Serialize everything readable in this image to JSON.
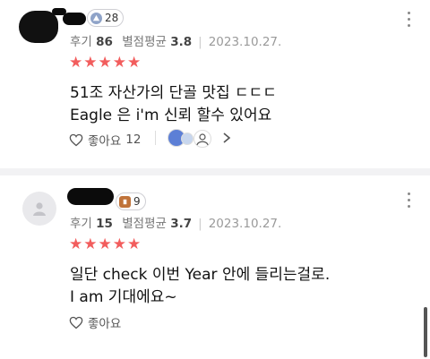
{
  "reviews": [
    {
      "badge_count": "28",
      "review_label": "후기",
      "review_count": "86",
      "avg_label": "별점평균",
      "avg_value": "3.8",
      "date": "2023.10.27.",
      "stars": "★★★★★",
      "lines": [
        "51조 자산가의 단골 맛집 ㄷㄷㄷ",
        "Eagle 은 i'm 신뢰 할수 있어요"
      ],
      "like_label": "좋아요",
      "like_count": "12"
    },
    {
      "badge_count": "9",
      "review_label": "후기",
      "review_count": "15",
      "avg_label": "별점평균",
      "avg_value": "3.7",
      "date": "2023.10.27.",
      "stars": "★★★★★",
      "lines": [
        "일단 check 이번 Year 안에 들리는걸로.",
        "I am 기대에요~"
      ],
      "like_label": "좋아요"
    }
  ],
  "icons": [
    "more-vertical-icon",
    "heart-outline-icon",
    "chevron-right-icon",
    "person-icon",
    "level-badge-icon"
  ],
  "colors": {
    "star": "#f25d5d",
    "badge_blue": "#8fa3c8",
    "badge_brown": "#c0733a"
  }
}
